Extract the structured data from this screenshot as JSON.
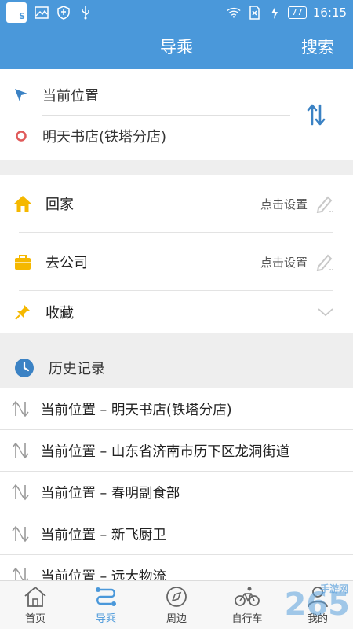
{
  "status_bar": {
    "time": "16:15",
    "battery": "77",
    "app_badge": "S",
    "icons": [
      "app-icon",
      "image-icon",
      "shield-icon",
      "usb-icon",
      "wifi-icon",
      "no-sim-icon",
      "charging-icon",
      "battery-icon"
    ]
  },
  "header": {
    "title": "导乘",
    "search_label": "搜索"
  },
  "route": {
    "origin": "当前位置",
    "destination": "明天书店(铁塔分店)"
  },
  "quick": {
    "home_label": "回家",
    "home_action": "点击设置",
    "work_label": "去公司",
    "work_action": "点击设置",
    "favorites_label": "收藏"
  },
  "history": {
    "title": "历史记录",
    "items": [
      "当前位置 – 明天书店(铁塔分店)",
      "当前位置 – 山东省济南市历下区龙洞街道",
      "当前位置 – 春明副食部",
      "当前位置 – 新飞厨卫",
      "当前位置 – 远大物流"
    ]
  },
  "nav": {
    "items": [
      {
        "label": "首页",
        "icon": "home-icon"
      },
      {
        "label": "导乘",
        "icon": "route-icon"
      },
      {
        "label": "周边",
        "icon": "compass-icon"
      },
      {
        "label": "自行车",
        "icon": "bicycle-icon"
      },
      {
        "label": "我的",
        "icon": "user-icon"
      }
    ],
    "active_index": 1
  },
  "watermark": {
    "text": "265",
    "site": "手游网"
  },
  "colors": {
    "primary": "#4a98da",
    "home_icon": "#f5b800",
    "origin_arrow": "#3b82c4",
    "destination_dot": "#e05a5a"
  }
}
